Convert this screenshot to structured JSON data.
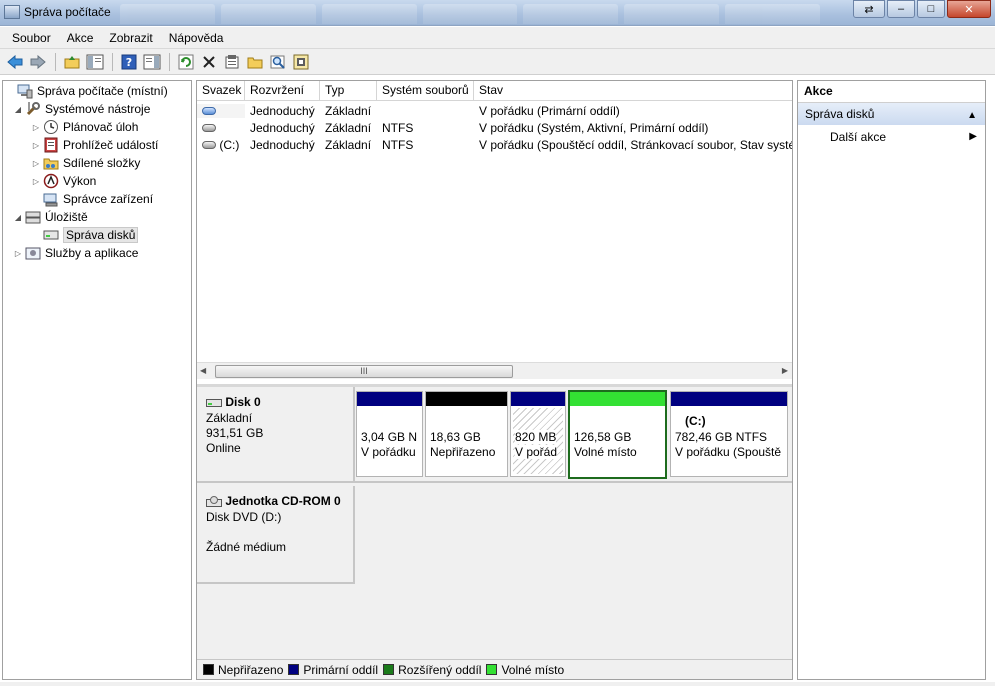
{
  "window": {
    "title": "Správa počítače",
    "controls": {
      "minimize": "–",
      "maximize": "□",
      "close": "✕"
    }
  },
  "menu": [
    "Soubor",
    "Akce",
    "Zobrazit",
    "Nápověda"
  ],
  "toolbar_icons": [
    "back-icon",
    "forward-icon",
    "up-folder-icon",
    "show-hide-tree-icon",
    "help-icon",
    "show-hide-action-pane-icon",
    "refresh-icon",
    "delete-icon",
    "properties-icon",
    "open-icon",
    "search-icon",
    "settings-icon"
  ],
  "tree": {
    "items": [
      {
        "label": "Správa počítače (místní)",
        "icon": "computer-management-icon",
        "expander": ""
      },
      {
        "label": "Systémové nástroje",
        "icon": "tools-icon",
        "expander": "◢"
      },
      {
        "label": "Plánovač úloh",
        "icon": "task-scheduler-icon",
        "expander": "▷"
      },
      {
        "label": "Prohlížeč událostí",
        "icon": "event-viewer-icon",
        "expander": "▷"
      },
      {
        "label": "Sdílené složky",
        "icon": "shared-folders-icon",
        "expander": "▷"
      },
      {
        "label": "Výkon",
        "icon": "performance-icon",
        "expander": "▷"
      },
      {
        "label": "Správce zařízení",
        "icon": "device-manager-icon",
        "expander": ""
      },
      {
        "label": "Úložiště",
        "icon": "storage-icon",
        "expander": "◢"
      },
      {
        "label": "Správa disků",
        "icon": "disk-management-icon",
        "expander": ""
      },
      {
        "label": "Služby a aplikace",
        "icon": "services-icon",
        "expander": "▷"
      }
    ]
  },
  "volumes": {
    "headers": [
      "Svazek",
      "Rozvržení",
      "Typ",
      "Systém souborů",
      "Stav"
    ],
    "rows": [
      {
        "volume": "",
        "layout": "Jednoduchý",
        "type": "Základní",
        "fs": "",
        "status": "V pořádku (Primární oddíl)"
      },
      {
        "volume": "",
        "layout": "Jednoduchý",
        "type": "Základní",
        "fs": "NTFS",
        "status": "V pořádku (Systém, Aktivní, Primární oddíl)"
      },
      {
        "volume": "(C:)",
        "layout": "Jednoduchý",
        "type": "Základní",
        "fs": "NTFS",
        "status": "V pořádku (Spouštěcí oddíl, Stránkovací soubor, Stav systém"
      }
    ],
    "scroll_grip": "III"
  },
  "disks": {
    "disk0": {
      "name": "Disk 0",
      "kind": "Základní",
      "size": "931,51 GB",
      "state": "Online",
      "partitions": [
        {
          "line1": "3,04 GB N",
          "line2": "V pořádku",
          "bar_color": "#000080"
        },
        {
          "line1": "18,63 GB",
          "line2": "Nepřiřazeno",
          "bar_color": "#000000"
        },
        {
          "line1": "820 MB",
          "line2": "V pořád",
          "bar_color": "#000080"
        },
        {
          "line1": "126,58 GB",
          "line2": "Volné místo",
          "bar_color": "#33e033"
        },
        {
          "label": "(C:)",
          "line1": "782,46 GB NTFS",
          "line2": "V pořádku (Spouště",
          "bar_color": "#000080"
        }
      ]
    },
    "cdrom": {
      "name": "Jednotka CD-ROM 0",
      "kind": "Disk DVD (D:)",
      "state": "Žádné médium"
    }
  },
  "legend": [
    {
      "label": "Nepřiřazeno",
      "color": "#000000"
    },
    {
      "label": "Primární oddíl",
      "color": "#000080"
    },
    {
      "label": "Rozšířený oddíl",
      "color": "#1a7a1a"
    },
    {
      "label": "Volné místo",
      "color": "#33e033"
    }
  ],
  "actions": {
    "heading": "Akce",
    "section": "Správa disků",
    "more": "Další akce",
    "section_arrow": "▲",
    "more_arrow": "▶"
  }
}
